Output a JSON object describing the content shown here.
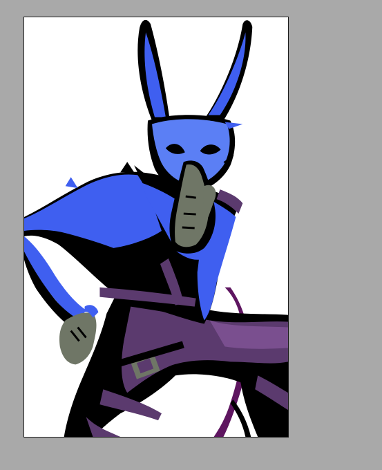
{
  "canvas": {
    "workspace_color": "#a9a9a9",
    "artboard_color": "#ffffff",
    "border_color": "#1a1a1a"
  },
  "artwork": {
    "subject": "rabbit-masked-figure",
    "palette": {
      "blue": "#3f5ff0",
      "blue_light": "#5b7ff5",
      "black": "#000000",
      "olive": "#6f7666",
      "purple": "#5b3a6e",
      "purple_light": "#7a4f8f",
      "magenta": "#5e1560"
    }
  }
}
